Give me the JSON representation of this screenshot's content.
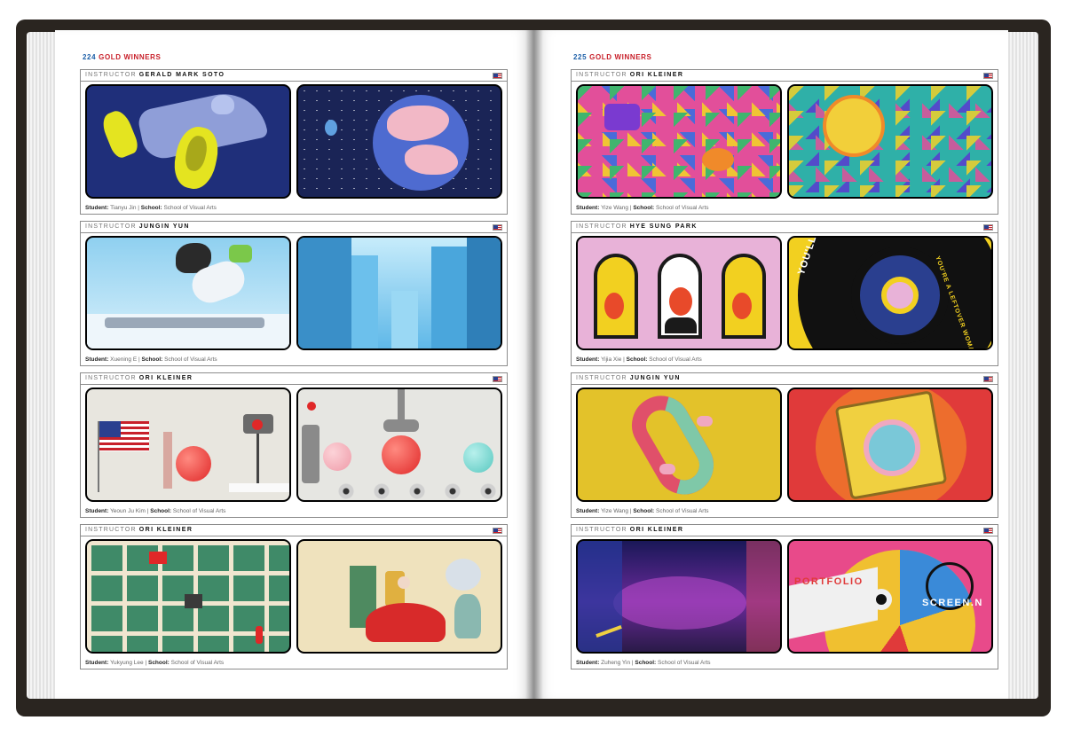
{
  "left_page": {
    "page_number": "224",
    "section_title": "GOLD WINNERS",
    "entries": [
      {
        "instructor_label": "INSTRUCTOR",
        "instructor": "GERALD MARK SOTO",
        "student_label": "Student:",
        "student": "Tianyu Jin",
        "separator": "|",
        "school_label": "School:",
        "school": "School of Visual Arts"
      },
      {
        "instructor_label": "INSTRUCTOR",
        "instructor": "JUNGIN YUN",
        "student_label": "Student:",
        "student": "Xuening E",
        "separator": "|",
        "school_label": "School:",
        "school": "School of Visual Arts"
      },
      {
        "instructor_label": "INSTRUCTOR",
        "instructor": "ORI KLEINER",
        "student_label": "Student:",
        "student": "Yeoun Ju Kim",
        "separator": "|",
        "school_label": "School:",
        "school": "School of Visual Arts"
      },
      {
        "instructor_label": "INSTRUCTOR",
        "instructor": "ORI KLEINER",
        "student_label": "Student:",
        "student": "Yukyung Lee",
        "separator": "|",
        "school_label": "School:",
        "school": "School of Visual Arts"
      }
    ]
  },
  "right_page": {
    "page_number": "225",
    "section_title": "GOLD WINNERS",
    "entries": [
      {
        "instructor_label": "INSTRUCTOR",
        "instructor": "ORI KLEINER",
        "student_label": "Student:",
        "student": "Yize Wang",
        "separator": "|",
        "school_label": "School:",
        "school": "School of Visual Arts"
      },
      {
        "instructor_label": "INSTRUCTOR",
        "instructor": "HYE SUNG PARK",
        "student_label": "Student:",
        "student": "Yijia Xie",
        "separator": "|",
        "school_label": "School:",
        "school": "School of Visual Arts"
      },
      {
        "instructor_label": "INSTRUCTOR",
        "instructor": "JUNGIN YUN",
        "student_label": "Student:",
        "student": "Yize Wang",
        "separator": "|",
        "school_label": "School:",
        "school": "School of Visual Arts"
      },
      {
        "instructor_label": "INSTRUCTOR",
        "instructor": "ORI KLEINER",
        "student_label": "Student:",
        "student": "Zuheng Yin",
        "separator": "|",
        "school_label": "School:",
        "school": "School of Visual Arts"
      }
    ]
  },
  "artwork_text": {
    "you_ll_die_alone": "YOU'LL DIE ALO",
    "leftover_woman": "YOU'RE A LEFTOVER WOMAN",
    "portfolio": "PORTFOLIO",
    "screening": "SCREEN.N"
  },
  "colors": {
    "page_number_blue": "#1c5fa8",
    "title_red": "#c8202a",
    "cover": "#2a2520"
  }
}
